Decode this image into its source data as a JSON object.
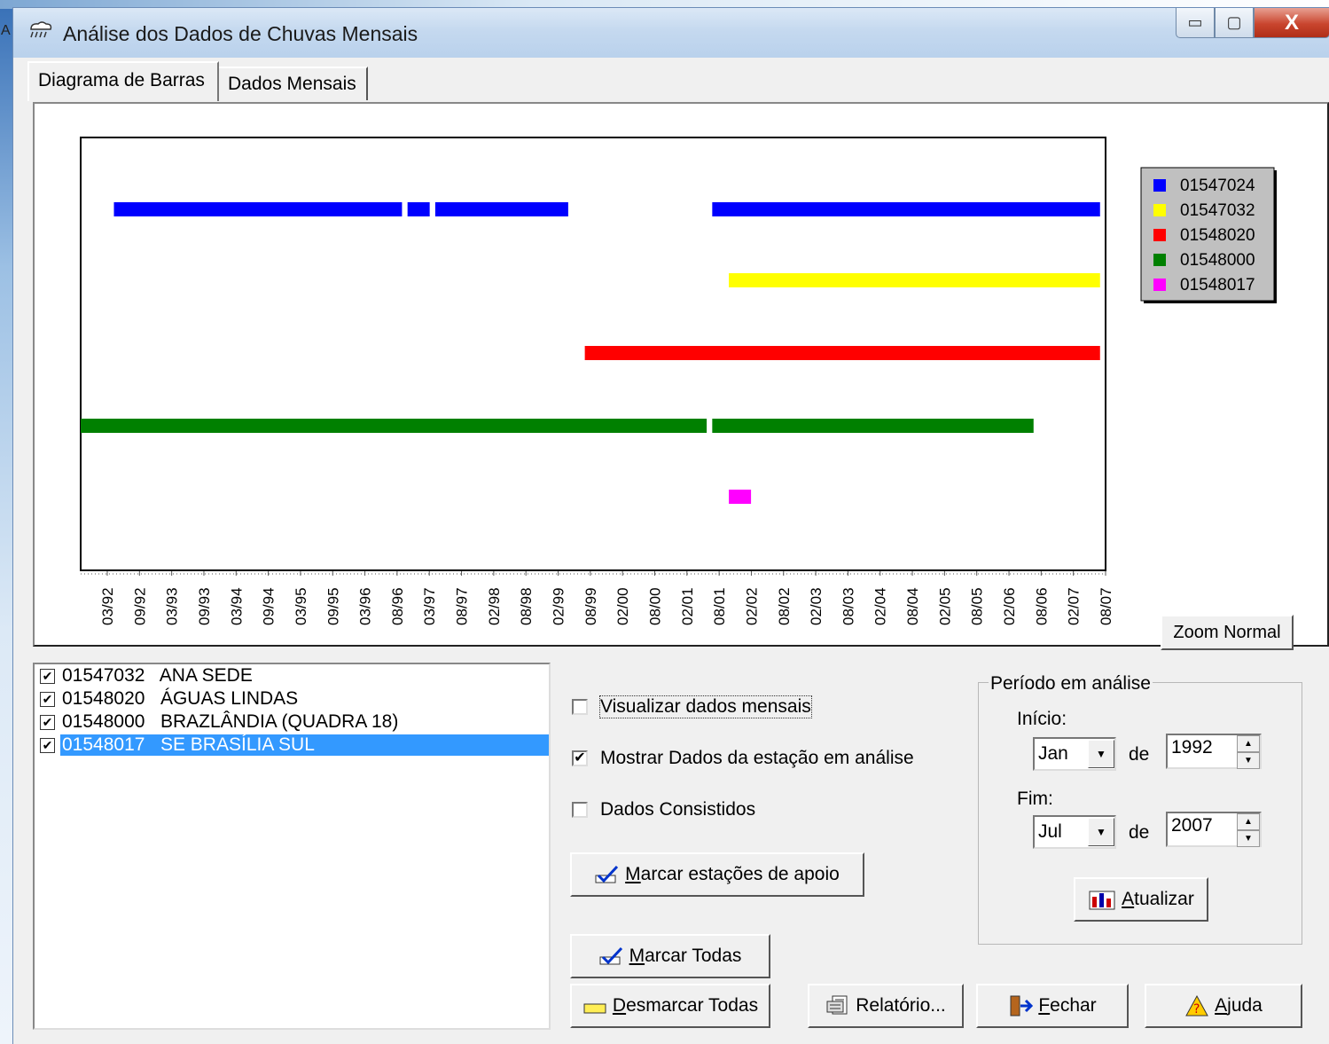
{
  "window": {
    "title": "Análise dos Dados de Chuvas Mensais",
    "desktop_label": "A",
    "controls": {
      "minimize": "▭",
      "maximize": "▢",
      "close": "X"
    }
  },
  "tabs": [
    {
      "label": "Diagrama de Barras",
      "active": true
    },
    {
      "label": "Dados Mensais",
      "active": false
    }
  ],
  "chart_data": {
    "type": "bar",
    "title": "",
    "x_tick_labels": [
      "03/92",
      "09/92",
      "03/93",
      "09/93",
      "03/94",
      "09/94",
      "03/95",
      "09/95",
      "03/96",
      "08/96",
      "03/97",
      "08/97",
      "02/98",
      "08/98",
      "02/99",
      "08/99",
      "02/00",
      "08/00",
      "02/01",
      "08/01",
      "02/02",
      "08/02",
      "02/03",
      "08/03",
      "02/04",
      "08/04",
      "02/05",
      "08/05",
      "02/06",
      "08/06",
      "02/07",
      "08/07"
    ],
    "series": [
      {
        "name": "01547024",
        "color": "#0000ff",
        "periods": [
          [
            "1992-09",
            "1997-01"
          ],
          [
            "1997-02",
            "1997-06"
          ],
          [
            "1997-07",
            "1999-07"
          ],
          [
            "2001-09",
            "2007-07"
          ]
        ]
      },
      {
        "name": "01547032",
        "color": "#ffff00",
        "periods": [
          [
            "2001-12",
            "2007-07"
          ]
        ]
      },
      {
        "name": "01548020",
        "color": "#ff0000",
        "periods": [
          [
            "1999-10",
            "2007-07"
          ]
        ]
      },
      {
        "name": "01548000",
        "color": "#008000",
        "periods": [
          [
            "1992-03",
            "2001-08"
          ],
          [
            "2001-09",
            "2006-07"
          ]
        ]
      },
      {
        "name": "01548017",
        "color": "#ff00ff",
        "periods": [
          [
            "2001-12",
            "2002-04"
          ]
        ]
      }
    ],
    "legend_position": "top-right",
    "grid": false
  },
  "zoom_button": "Zoom Normal",
  "station_list": [
    {
      "checked": true,
      "code": "01547032",
      "name": "ANA SEDE",
      "selected": false
    },
    {
      "checked": true,
      "code": "01548020",
      "name": "ÁGUAS LINDAS",
      "selected": false
    },
    {
      "checked": true,
      "code": "01548000",
      "name": "BRAZLÂNDIA (QUADRA 18)",
      "selected": false
    },
    {
      "checked": true,
      "code": "01548017",
      "name": "SE BRASÍLIA SUL",
      "selected": true
    }
  ],
  "options": {
    "visualizar": {
      "label": "Visualizar dados mensais",
      "checked": false
    },
    "mostrar": {
      "label": "Mostrar Dados da estação em análise",
      "checked": true
    },
    "consistidos": {
      "label": "Dados Consistidos",
      "checked": false
    }
  },
  "buttons": {
    "marcar_apoio": {
      "u": "M",
      "rest": "arcar estações de apoio"
    },
    "marcar_todas": {
      "u": "M",
      "rest": "arcar Todas"
    },
    "desmarcar_todas": {
      "u": "D",
      "rest": "esmarcar Todas"
    },
    "relatorio": {
      "label": "Relatório..."
    },
    "fechar": {
      "u": "F",
      "rest": "echar"
    },
    "ajuda": {
      "u": "A",
      "rest": "juda"
    },
    "atualizar": {
      "u": "A",
      "rest": "tualizar"
    }
  },
  "periodo": {
    "title": "Período em análise",
    "inicio_label": "Início:",
    "fim_label": "Fim:",
    "de": "de",
    "inicio_month": "Jan",
    "inicio_year": "1992",
    "fim_month": "Jul",
    "fim_year": "2007"
  }
}
